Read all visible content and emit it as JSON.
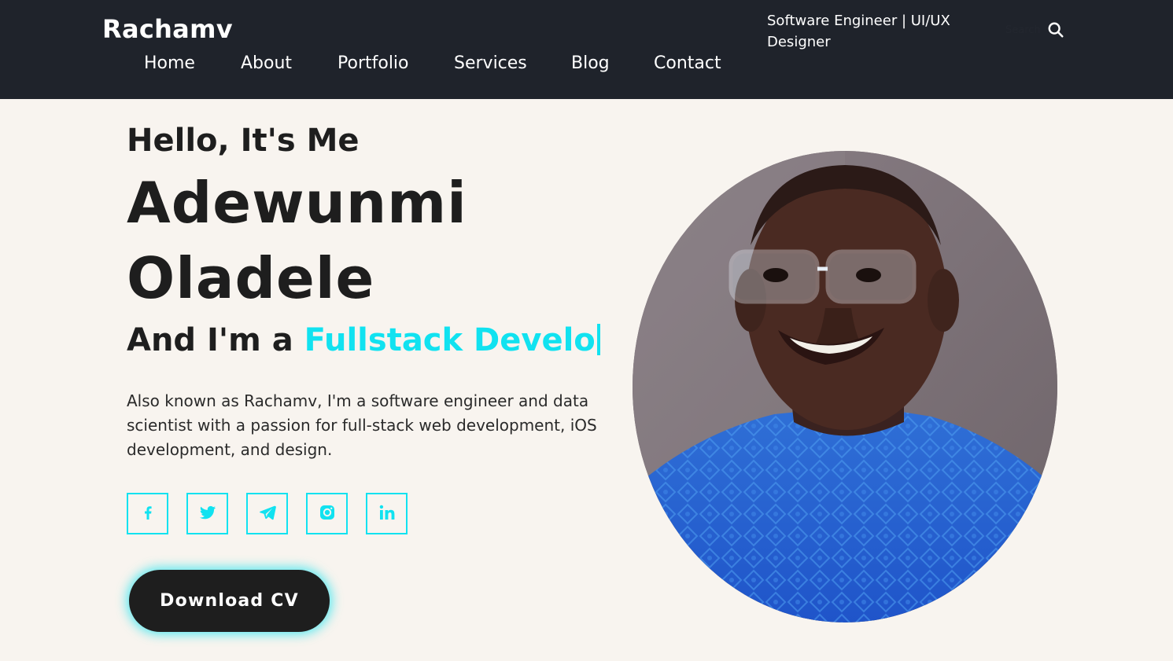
{
  "header": {
    "logo": "Rachamv",
    "nav": [
      {
        "label": "Home"
      },
      {
        "label": "About"
      },
      {
        "label": "Portfolio"
      },
      {
        "label": "Services"
      },
      {
        "label": "Blog"
      },
      {
        "label": "Contact"
      }
    ],
    "tagline": "Software Engineer | UI/UX Designer",
    "search": {
      "placeholder": "Search",
      "icon": "search-icon"
    }
  },
  "hero": {
    "greeting": "Hello, It's Me",
    "first_name": "Adewunmi",
    "last_name": "Oladele",
    "role_prefix": "And I'm a",
    "role_typed": "Fullstack Develo",
    "bio": "Also known as Rachamv, I'm a software engineer and data scientist with a passion for full-stack web development, iOS development, and design.",
    "socials": [
      {
        "icon": "facebook-icon"
      },
      {
        "icon": "twitter-icon"
      },
      {
        "icon": "telegram-icon"
      },
      {
        "icon": "instagram-icon"
      },
      {
        "icon": "linkedin-icon"
      }
    ],
    "cv_button": "Download CV"
  },
  "colors": {
    "accent": "#11e2f0",
    "header_bg": "#1f232b",
    "page_bg": "#f8f4ef",
    "text_dark": "#1e1e1e"
  }
}
